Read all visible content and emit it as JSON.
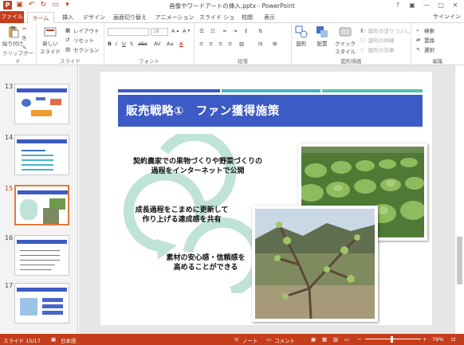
{
  "window": {
    "title": "画像やワードアートの挿入.pptx - PowerPoint",
    "sign_in": "サインイン",
    "minimize": "—",
    "restore": "□",
    "close": "✕",
    "help": "?"
  },
  "tabs": [
    "ファイル",
    "ホーム",
    "挿入",
    "デザイン",
    "画面切り替え",
    "アニメーション",
    "スライド ショー",
    "校閲",
    "表示"
  ],
  "ribbon": {
    "clipboard": {
      "paste": "貼り付け",
      "label": "クリップボード"
    },
    "slides": {
      "new_slide": "新しい\nスライド",
      "layout": "レイアウト",
      "reset": "リセット",
      "section": "セクション",
      "label": "スライド"
    },
    "font": {
      "label": "フォント",
      "size": "18"
    },
    "paragraph": {
      "label": "段落"
    },
    "drawing": {
      "shapes": "図形",
      "arrange": "配置",
      "quick_styles": "クイック\nスタイル",
      "fill": "図形の塗りつぶし",
      "outline": "図形の枠線",
      "effects": "図形の効果",
      "label": "図形描画"
    },
    "editing": {
      "find": "検索",
      "replace": "置換",
      "select": "選択",
      "label": "編集"
    }
  },
  "thumbnails": [
    {
      "num": "13",
      "active": false
    },
    {
      "num": "14",
      "active": false
    },
    {
      "num": "15",
      "active": true
    },
    {
      "num": "16",
      "active": false
    },
    {
      "num": "17",
      "active": false
    }
  ],
  "slide": {
    "title": "販売戦略①　ファン獲得施策",
    "steps": [
      "契約農家での果物づくりや野菜づくりの\n過程をインターネットで公開",
      "成長過程をこまめに更新して\n作り上げる達成感を共有",
      "素材の安心感・信頼感を\n高めることができる"
    ],
    "colors": {
      "title_bg": "#3d5bc4",
      "arrow": "#bfe3d7",
      "stripe_dark": "#3d5bc4",
      "stripe_light": "#47b3c8",
      "stripe_teal": "#55c1b0"
    }
  },
  "status": {
    "slide": "スライド 15/17",
    "language": "日本語",
    "notes": "ノート",
    "comments": "コメント",
    "zoom": "79%"
  }
}
